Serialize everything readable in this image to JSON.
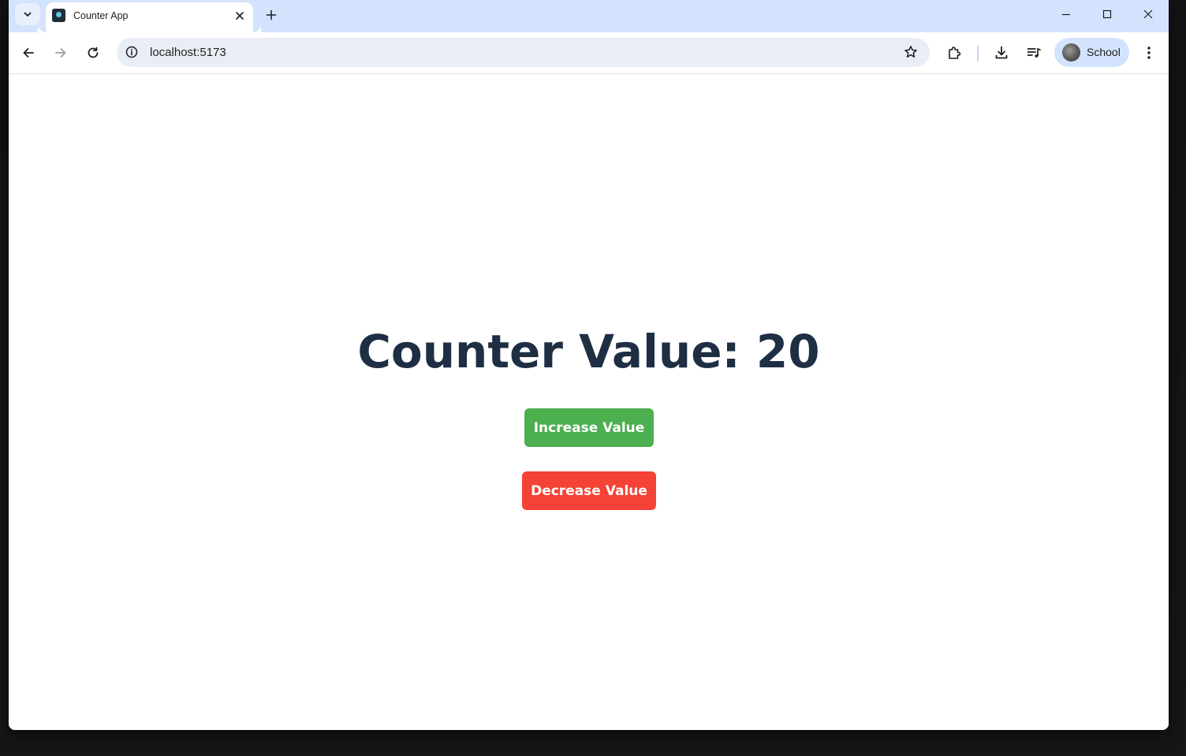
{
  "browser": {
    "tab": {
      "title": "Counter App"
    },
    "address_bar": {
      "url": "localhost:5173"
    },
    "profile": {
      "name": "School"
    },
    "icons": {
      "tab_search": "chevron-down-icon",
      "tab_close": "close-icon",
      "new_tab": "plus-icon",
      "minimize": "minimize-icon",
      "maximize": "maximize-icon",
      "close_window": "close-icon",
      "back": "arrow-left-icon",
      "forward": "arrow-right-icon",
      "reload": "reload-icon",
      "site_info": "info-icon",
      "bookmark": "star-icon",
      "extensions": "puzzle-icon",
      "downloads": "download-icon",
      "media": "media-queue-icon",
      "menu": "kebab-menu-icon"
    },
    "colors": {
      "tabstrip": "#d3e3fd",
      "omnibox": "#e9eef6"
    }
  },
  "app": {
    "title": "Counter Value: 20",
    "counter_value": 20,
    "increase_label": "Increase Value",
    "decrease_label": "Decrease Value",
    "colors": {
      "title": "#1e2f44",
      "increase": "#4caf50",
      "decrease": "#f44336"
    }
  }
}
